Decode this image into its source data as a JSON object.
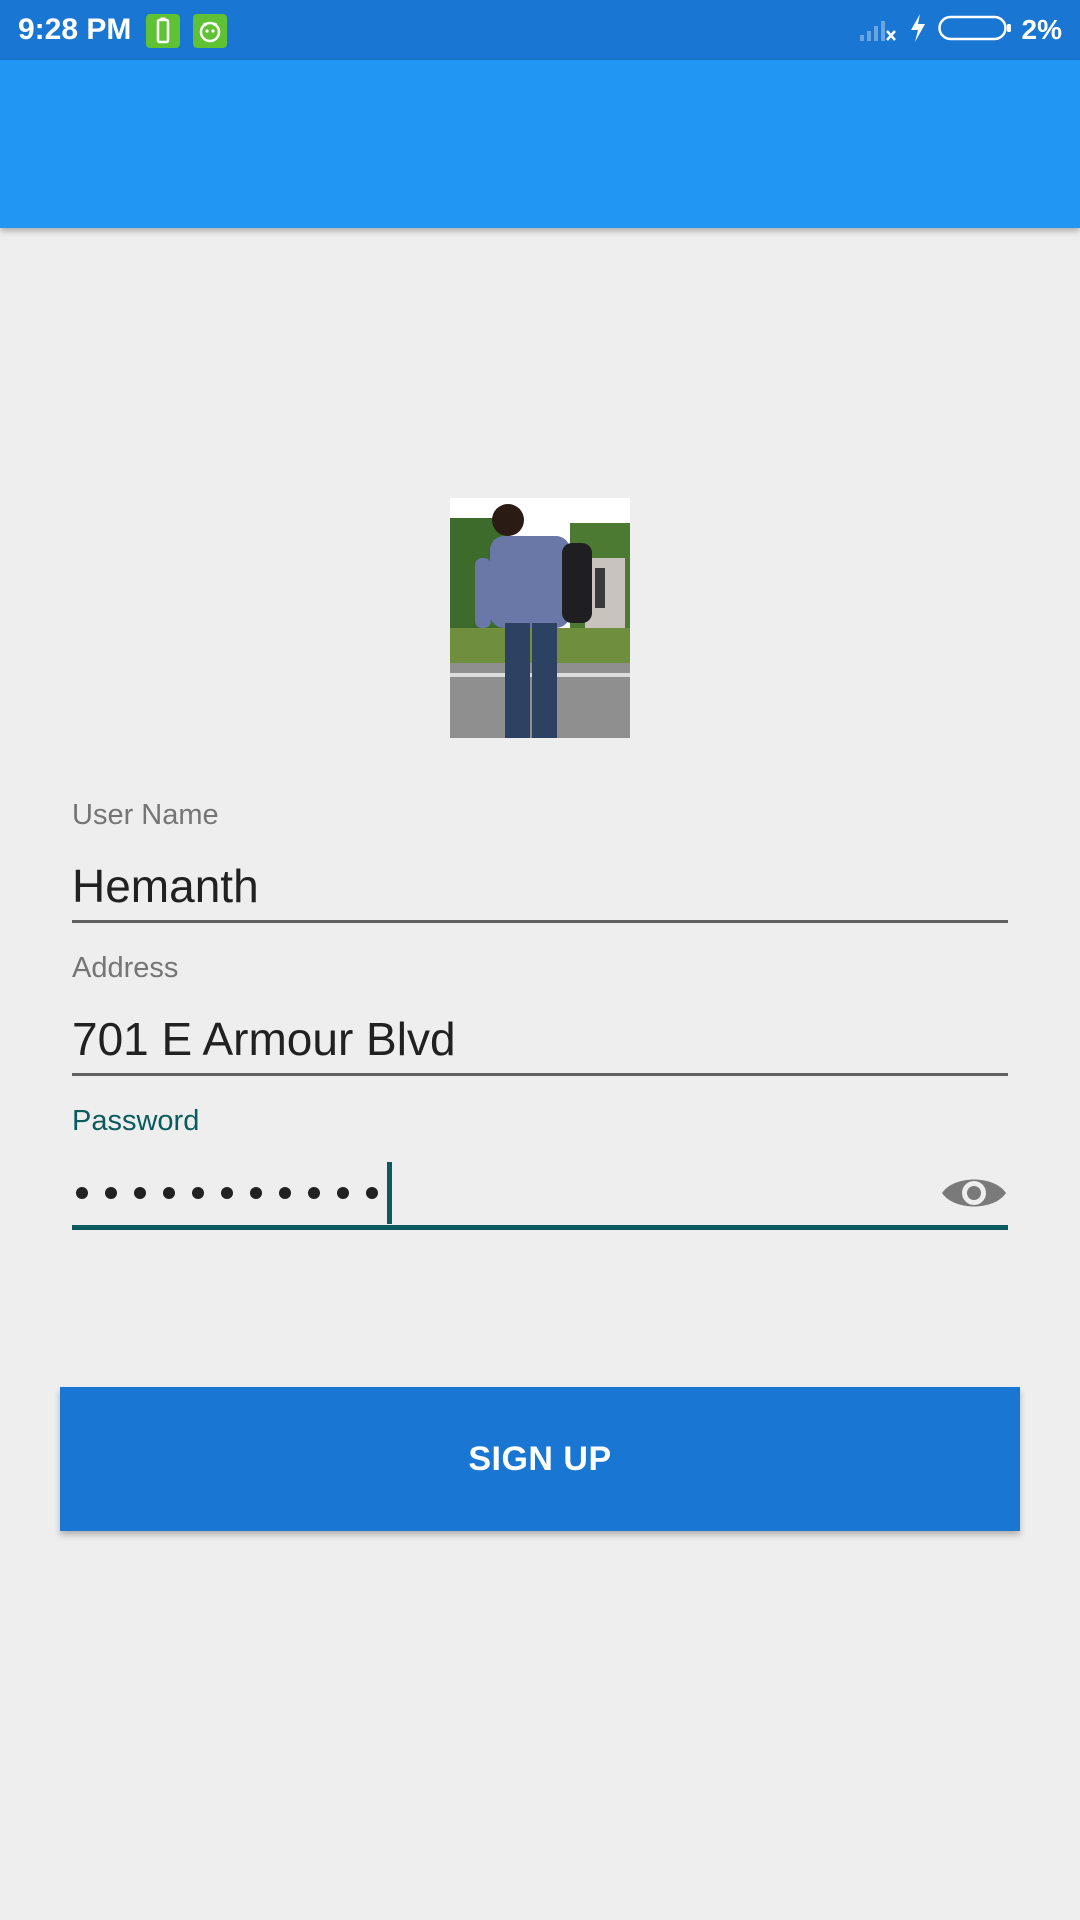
{
  "status_bar": {
    "time": "9:28 PM",
    "battery_percent": "2%",
    "notification_icons": [
      "battery-saver-icon",
      "android-debug-icon"
    ],
    "status_icons": [
      "no-signal-icon",
      "charging-bolt-icon",
      "battery-icon"
    ]
  },
  "app_bar": {
    "color": "#2196f3"
  },
  "avatar": {
    "icon": "profile-photo"
  },
  "form": {
    "username": {
      "label": "User Name",
      "value": "Hemanth"
    },
    "address": {
      "label": "Address",
      "value": "701 E Armour Blvd"
    },
    "password": {
      "label": "Password",
      "masked_length": 11,
      "toggle_icon": "eye-icon",
      "accent_color": "#0b5a5d"
    }
  },
  "actions": {
    "signup_label": "SIGN UP",
    "button_color": "#1976d2"
  }
}
